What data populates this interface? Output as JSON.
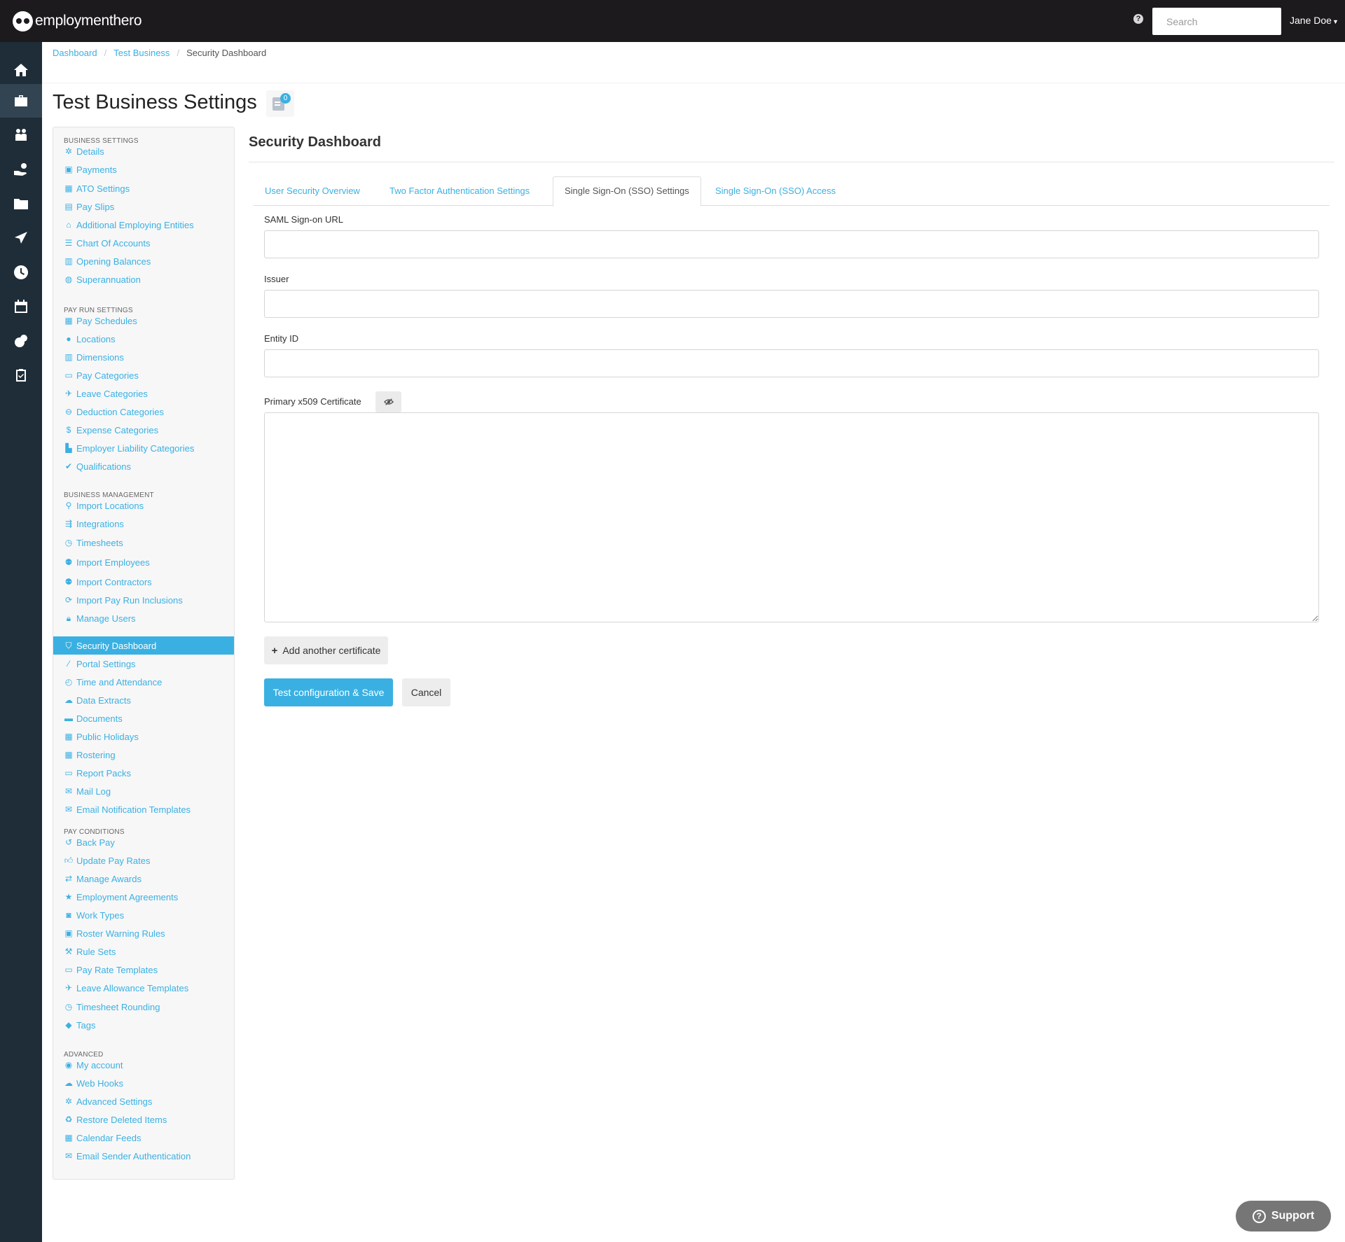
{
  "header": {
    "logo_text": "employmenthero",
    "search": {
      "placeholder": "Search",
      "value": ""
    },
    "user_name": "Jane Doe"
  },
  "rail": {
    "items": [
      {
        "icon": "home-icon"
      },
      {
        "icon": "briefcase-icon",
        "active": true
      },
      {
        "icon": "people-icon"
      },
      {
        "icon": "hand-coin-icon"
      },
      {
        "icon": "folder-icon"
      },
      {
        "icon": "plane-icon"
      },
      {
        "icon": "clock-icon"
      },
      {
        "icon": "calendar-icon"
      },
      {
        "icon": "dollar-icon"
      },
      {
        "icon": "clipboard-check-icon"
      }
    ]
  },
  "breadcrumb": {
    "items": [
      "Dashboard",
      "Test Business",
      "Security Dashboard"
    ]
  },
  "page": {
    "title": "Test Business Settings",
    "notes_count": "0"
  },
  "sidebar": {
    "sections": [
      {
        "title": "BUSINESS SETTINGS",
        "items": [
          {
            "label": "Details",
            "icon": "gear-icon"
          },
          {
            "label": "Payments",
            "icon": "save-icon"
          },
          {
            "label": "ATO Settings",
            "icon": "calculator-icon"
          },
          {
            "label": "Pay Slips",
            "icon": "file-icon"
          },
          {
            "label": "Additional Employing Entities",
            "icon": "bank-icon"
          },
          {
            "label": "Chart Of Accounts",
            "icon": "list-icon"
          },
          {
            "label": "Opening Balances",
            "icon": "balance-icon"
          },
          {
            "label": "Superannuation",
            "icon": "globe-icon"
          }
        ]
      },
      {
        "title": "PAY RUN SETTINGS",
        "items": [
          {
            "label": "Pay Schedules",
            "icon": "calendar-icon"
          },
          {
            "label": "Locations",
            "icon": "globe-icon"
          },
          {
            "label": "Dimensions",
            "icon": "bar-chart-icon"
          },
          {
            "label": "Pay Categories",
            "icon": "money-icon"
          },
          {
            "label": "Leave Categories",
            "icon": "plane-icon"
          },
          {
            "label": "Deduction Categories",
            "icon": "minus-circle-icon"
          },
          {
            "label": "Expense Categories",
            "icon": "dollar-icon"
          },
          {
            "label": "Employer Liability Categories",
            "icon": "factory-icon"
          },
          {
            "label": "Qualifications",
            "icon": "check-icon"
          }
        ]
      },
      {
        "title": "BUSINESS MANAGEMENT",
        "items": [
          {
            "label": "Import Locations",
            "icon": "map-pin-icon"
          },
          {
            "label": "Integrations",
            "icon": "plug-icon"
          },
          {
            "label": "Timesheets",
            "icon": "clock-icon"
          },
          {
            "label": "Import Employees",
            "icon": "users-icon"
          },
          {
            "label": "Import Contractors",
            "icon": "users-icon"
          },
          {
            "label": "Import Pay Run Inclusions",
            "icon": "refresh-icon"
          },
          {
            "label": "Manage Users",
            "icon": "lock-icon"
          },
          {
            "label": "Security Dashboard",
            "icon": "shield-icon",
            "active": true
          },
          {
            "label": "Portal Settings",
            "icon": "wand-icon"
          },
          {
            "label": "Time and Attendance",
            "icon": "stopwatch-icon"
          },
          {
            "label": "Data Extracts",
            "icon": "cloud-download-icon"
          },
          {
            "label": "Documents",
            "icon": "folder-icon"
          },
          {
            "label": "Public Holidays",
            "icon": "calendar-icon"
          },
          {
            "label": "Rostering",
            "icon": "calendar-grid-icon"
          },
          {
            "label": "Report Packs",
            "icon": "folder-open-icon"
          },
          {
            "label": "Mail Log",
            "icon": "envelope-icon"
          },
          {
            "label": "Email Notification Templates",
            "icon": "envelope-icon"
          }
        ]
      },
      {
        "title": "PAY CONDITIONS",
        "items": [
          {
            "label": "Back Pay",
            "icon": "history-icon"
          },
          {
            "label": "Update Pay Rates",
            "icon": "thumbs-up-icon"
          },
          {
            "label": "Manage Awards",
            "icon": "exchange-icon"
          },
          {
            "label": "Employment Agreements",
            "icon": "star-icon"
          },
          {
            "label": "Work Types",
            "icon": "camera-icon"
          },
          {
            "label": "Roster Warning Rules",
            "icon": "calendar-warning-icon"
          },
          {
            "label": "Rule Sets",
            "icon": "gavel-icon"
          },
          {
            "label": "Pay Rate Templates",
            "icon": "money-icon"
          },
          {
            "label": "Leave Allowance Templates",
            "icon": "plane-icon"
          },
          {
            "label": "Timesheet Rounding",
            "icon": "clock-icon"
          },
          {
            "label": "Tags",
            "icon": "tag-icon"
          }
        ]
      },
      {
        "title": "ADVANCED",
        "items": [
          {
            "label": "My account",
            "icon": "user-circle-icon"
          },
          {
            "label": "Web Hooks",
            "icon": "cloud-icon"
          },
          {
            "label": "Advanced Settings",
            "icon": "gear-icon"
          },
          {
            "label": "Restore Deleted Items",
            "icon": "recycle-icon"
          },
          {
            "label": "Calendar Feeds",
            "icon": "calendar-icon"
          },
          {
            "label": "Email Sender Authentication",
            "icon": "envelope-icon"
          }
        ]
      }
    ]
  },
  "main": {
    "section_title": "Security Dashboard",
    "tabs": [
      {
        "label": "User Security Overview"
      },
      {
        "label": "Two Factor Authentication Settings"
      },
      {
        "label": "Single Sign-On (SSO) Settings",
        "active": true
      },
      {
        "label": "Single Sign-On (SSO) Access"
      }
    ],
    "form": {
      "saml_url": {
        "label": "SAML Sign-on URL",
        "value": ""
      },
      "issuer": {
        "label": "Issuer",
        "value": ""
      },
      "entity_id": {
        "label": "Entity ID",
        "value": ""
      },
      "certificate": {
        "label": "Primary x509 Certificate",
        "value": ""
      },
      "add_certificate_label": "Add another certificate",
      "save_label": "Test configuration & Save",
      "cancel_label": "Cancel"
    }
  },
  "support": {
    "label": "Support"
  },
  "colors": {
    "accent": "#3ab0e2",
    "topbar": "#1c1a1c",
    "rail": "#1e2d38"
  }
}
